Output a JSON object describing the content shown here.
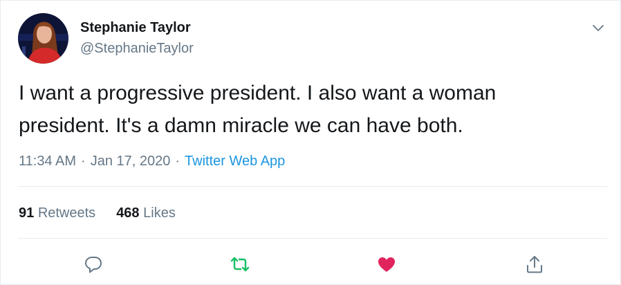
{
  "tweet": {
    "author": {
      "name": "Stephanie Taylor",
      "handle": "@StephanieTaylor"
    },
    "text": "I want a progressive president. I also want a woman\npresident. It's a damn miracle we can have both.",
    "meta": {
      "time": "11:34 AM",
      "date": "Jan 17, 2020",
      "source": "Twitter Web App",
      "separator": "·"
    },
    "stats": {
      "retweets_count": "91",
      "retweets_label": "Retweets",
      "likes_count": "468",
      "likes_label": "Likes"
    },
    "actions": {
      "reply_icon": "reply-icon",
      "retweet_icon": "retweet-icon",
      "like_icon": "heart-icon",
      "share_icon": "share-icon",
      "retweet_color": "#17bf63",
      "like_color": "#e0245e"
    },
    "colors": {
      "primary_text": "#14171a",
      "secondary_text": "#657786",
      "link": "#1b95e0",
      "border": "#e6ecf0"
    }
  }
}
